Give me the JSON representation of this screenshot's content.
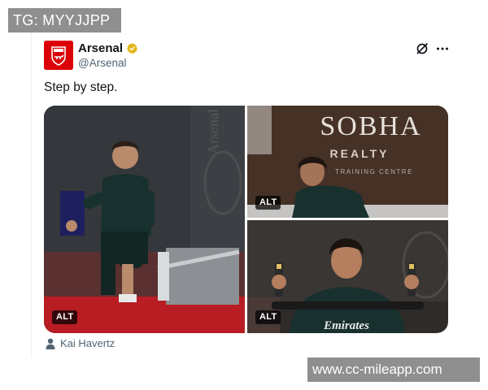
{
  "watermarks": {
    "top": "TG: MYYJJPP",
    "bottom": "www.cc-mileapp.com"
  },
  "tweet": {
    "display_name": "Arsenal",
    "handle": "@Arsenal",
    "verified": true,
    "text": "Step by step.",
    "media": {
      "images": [
        {
          "alt_label": "ALT"
        },
        {
          "alt_label": "ALT"
        },
        {
          "alt_label": "ALT"
        }
      ],
      "background_texts": {
        "banner_main": "SOBHA",
        "banner_sub": "REALTY",
        "banner_small": "TRAINING CENTRE",
        "wall_text": "Arsenal",
        "shirt_sponsor": "Emirates"
      }
    },
    "tagged_user": "Kai Havertz"
  },
  "icons": {
    "verified": "verified-badge-icon",
    "grok": "grok-icon",
    "more": "more-options-icon",
    "person": "person-tag-icon"
  },
  "colors": {
    "brand_red": "#db0007",
    "verified_gold": "#e2b719",
    "text_primary": "#0f1419",
    "text_secondary": "#536471"
  }
}
